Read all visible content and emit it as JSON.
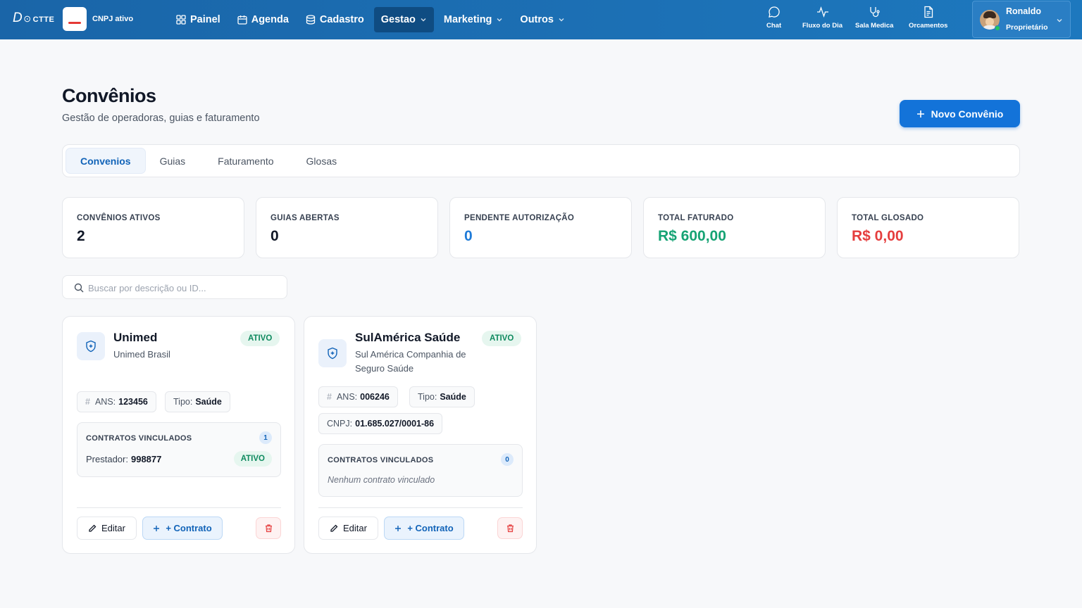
{
  "colors": {
    "nav_bg": "#1a65a8",
    "primary": "#1373d9",
    "success": "#16a374",
    "danger": "#e53e3e",
    "info": "#1f7bd8"
  },
  "topbar": {
    "logo_main": "D",
    "logo_rest": "CTTE",
    "company_status": "CNPJ ativo",
    "menu": [
      {
        "label": "Painel",
        "icon": "grid-icon"
      },
      {
        "label": "Agenda",
        "icon": "calendar-icon"
      },
      {
        "label": "Cadastro",
        "icon": "database-icon"
      },
      {
        "label": "Gestao",
        "active": true
      },
      {
        "label": "Marketing"
      },
      {
        "label": "Outros"
      }
    ],
    "quick": [
      {
        "label": "Chat",
        "icon": "chat-icon"
      },
      {
        "label": "Fluxo do Dia",
        "icon": "activity-icon"
      },
      {
        "label": "Sala Medica",
        "icon": "stethoscope-icon"
      },
      {
        "label": "Orcamentos",
        "icon": "document-icon"
      }
    ],
    "user": {
      "name": "Ronaldo",
      "role": "Proprietário"
    }
  },
  "page": {
    "title": "Convênios",
    "subtitle": "Gestão de operadoras, guias e faturamento",
    "new_button": "Novo Convênio"
  },
  "tabs": [
    {
      "label": "Convenios",
      "active": true
    },
    {
      "label": "Guias"
    },
    {
      "label": "Faturamento"
    },
    {
      "label": "Glosas"
    }
  ],
  "stats": [
    {
      "label": "CONVÊNIOS ATIVOS",
      "value": "2",
      "color": "#111827"
    },
    {
      "label": "GUIAS ABERTAS",
      "value": "0",
      "color": "#111827"
    },
    {
      "label": "PENDENTE AUTORIZAÇÃO",
      "value": "0",
      "color": "#1f7bd8"
    },
    {
      "label": "TOTAL FATURADO",
      "value": "R$ 600,00",
      "color": "#16a374"
    },
    {
      "label": "TOTAL GLOSADO",
      "value": "R$ 0,00",
      "color": "#e53e3e"
    }
  ],
  "search": {
    "placeholder": "Buscar por descrição ou ID..."
  },
  "cards": [
    {
      "name": "Unimed",
      "full_name": "Unimed Brasil",
      "status": "ATIVO",
      "ans_label": "ANS:",
      "ans": "123456",
      "tipo_label": "Tipo:",
      "tipo": "Saúde",
      "contracts_title": "CONTRATOS VINCULADOS",
      "contracts_count": "1",
      "contract": {
        "label": "Prestador:",
        "value": "998877",
        "status": "ATIVO"
      },
      "edit": "Editar",
      "add_contract": "+ Contrato"
    },
    {
      "name": "SulAmérica Saúde",
      "full_name": "Sul América Companhia de Seguro Saúde",
      "status": "ATIVO",
      "ans_label": "ANS:",
      "ans": "006246",
      "tipo_label": "Tipo:",
      "tipo": "Saúde",
      "cnpj_label": "CNPJ:",
      "cnpj": "01.685.027/0001-86",
      "contracts_title": "CONTRATOS VINCULADOS",
      "contracts_count": "0",
      "empty": "Nenhum contrato vinculado",
      "edit": "Editar",
      "add_contract": "+ Contrato"
    }
  ]
}
